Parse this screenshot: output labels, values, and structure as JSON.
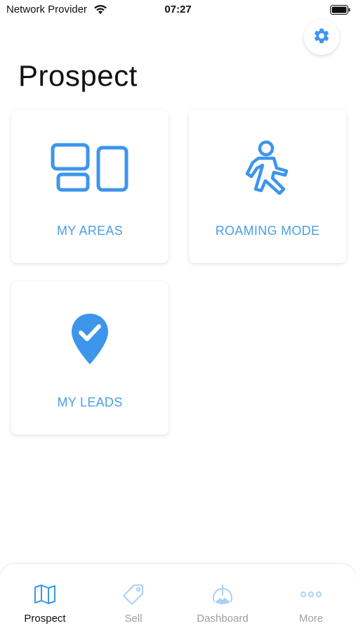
{
  "status_bar": {
    "carrier": "Network Provider",
    "time": "07:27"
  },
  "page": {
    "title": "Prospect"
  },
  "tiles": [
    {
      "label": "MY AREAS",
      "icon": "areas-layout-icon"
    },
    {
      "label": "ROAMING MODE",
      "icon": "walking-person-icon"
    },
    {
      "label": "MY LEADS",
      "icon": "location-check-icon"
    }
  ],
  "bottom_nav": {
    "items": [
      {
        "label": "Prospect",
        "icon": "map-icon",
        "active": true
      },
      {
        "label": "Sell",
        "icon": "tag-icon",
        "active": false
      },
      {
        "label": "Dashboard",
        "icon": "gauge-icon",
        "active": false
      },
      {
        "label": "More",
        "icon": "more-dots-icon",
        "active": false
      }
    ]
  },
  "colors": {
    "accent": "#4a9fe8",
    "icon_blue": "#3d95ec",
    "inactive": "#9aa0a6",
    "inactive_icon": "#a9d0f5"
  }
}
